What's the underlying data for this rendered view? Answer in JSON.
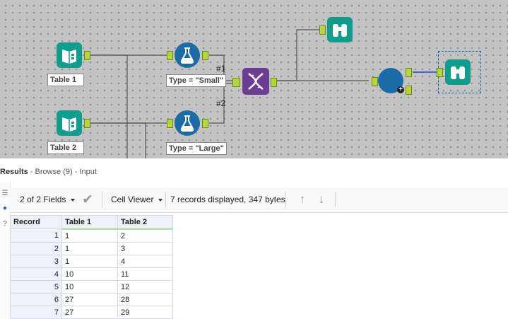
{
  "canvas": {
    "tools": {
      "table1_label": "Table 1",
      "table2_label": "Table 2",
      "filter_small_label": "Type = \"Small\"",
      "filter_large_label": "Type = \"Large\""
    },
    "connection_labels": {
      "top": "#1",
      "bottom": "#2"
    },
    "anchor_labels": {
      "join_output": "O",
      "join_input": "I"
    }
  },
  "results": {
    "title": "Results",
    "subtitle": "- Browse (9) - Input"
  },
  "toolbar": {
    "fields_label": "2 of 2 Fields",
    "viewer_label": "Cell Viewer",
    "status_text": "7 records displayed, 347 bytes"
  },
  "grid": {
    "columns": [
      "Record",
      "Table 1",
      "Table 2"
    ],
    "rows": [
      [
        "1",
        "1",
        "2"
      ],
      [
        "2",
        "1",
        "3"
      ],
      [
        "3",
        "1",
        "4"
      ],
      [
        "4",
        "10",
        "11"
      ],
      [
        "5",
        "10",
        "12"
      ],
      [
        "6",
        "27",
        "28"
      ],
      [
        "7",
        "27",
        "29"
      ]
    ]
  },
  "colors": {
    "accent_green": "#119d8c",
    "filter_blue": "#1a6ba7",
    "union_purple": "#6c3d96",
    "anchor_green": "#b4d63d",
    "wire_blue": "#2a3fcf"
  }
}
